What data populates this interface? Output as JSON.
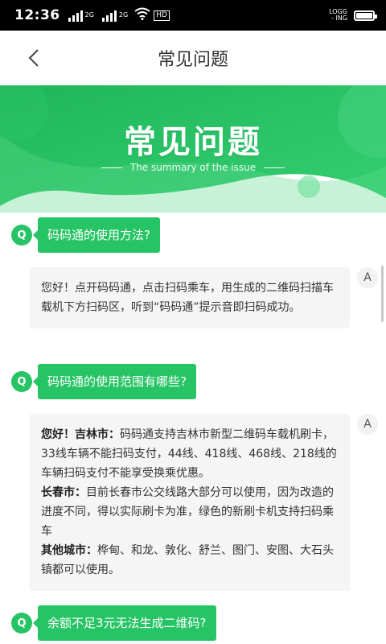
{
  "status_bar": {
    "time": "12:36",
    "signal1_label": "2G",
    "signal2_label": "2G",
    "hd_label": "HD",
    "carrier_line1": "LOGG",
    "carrier_line2": "- ING"
  },
  "nav": {
    "title": "常见问题"
  },
  "banner": {
    "title": "常见问题",
    "subtitle": "The summary of the issue",
    "colors": {
      "primary": "#27c465",
      "light": "#5fd98b",
      "dark": "#1fb158"
    }
  },
  "faq": {
    "q_label": "Q",
    "a_label": "A",
    "items": [
      {
        "question": "码码通的使用方法?",
        "answer": "您好！点开码码通，点击扫码乘车，用生成的二维码扫描车载机下方扫码区，听到“码码通”提示音即扫码成功。"
      },
      {
        "question": "码码通的使用范围有哪些?",
        "answer_parts": [
          {
            "label": "您好！吉林市：",
            "text": "码码通支持吉林市新型二维码车载机刷卡，33线车辆不能扫码支付，44线、418线、468线、218线的车辆扫码支付不能享受换乘优惠。"
          },
          {
            "label": "长春市：",
            "text": "目前长春市公交线路大部分可以使用，因为改造的进度不同，得以实际刷卡为准，绿色的新刷卡机支持扫码乘车"
          },
          {
            "label": "其他城市：",
            "text": "桦甸、和龙、敦化、舒兰、图门、安图、大石头镇都可以使用。"
          }
        ]
      },
      {
        "question": "余额不足3元无法生成二维码?"
      }
    ]
  }
}
